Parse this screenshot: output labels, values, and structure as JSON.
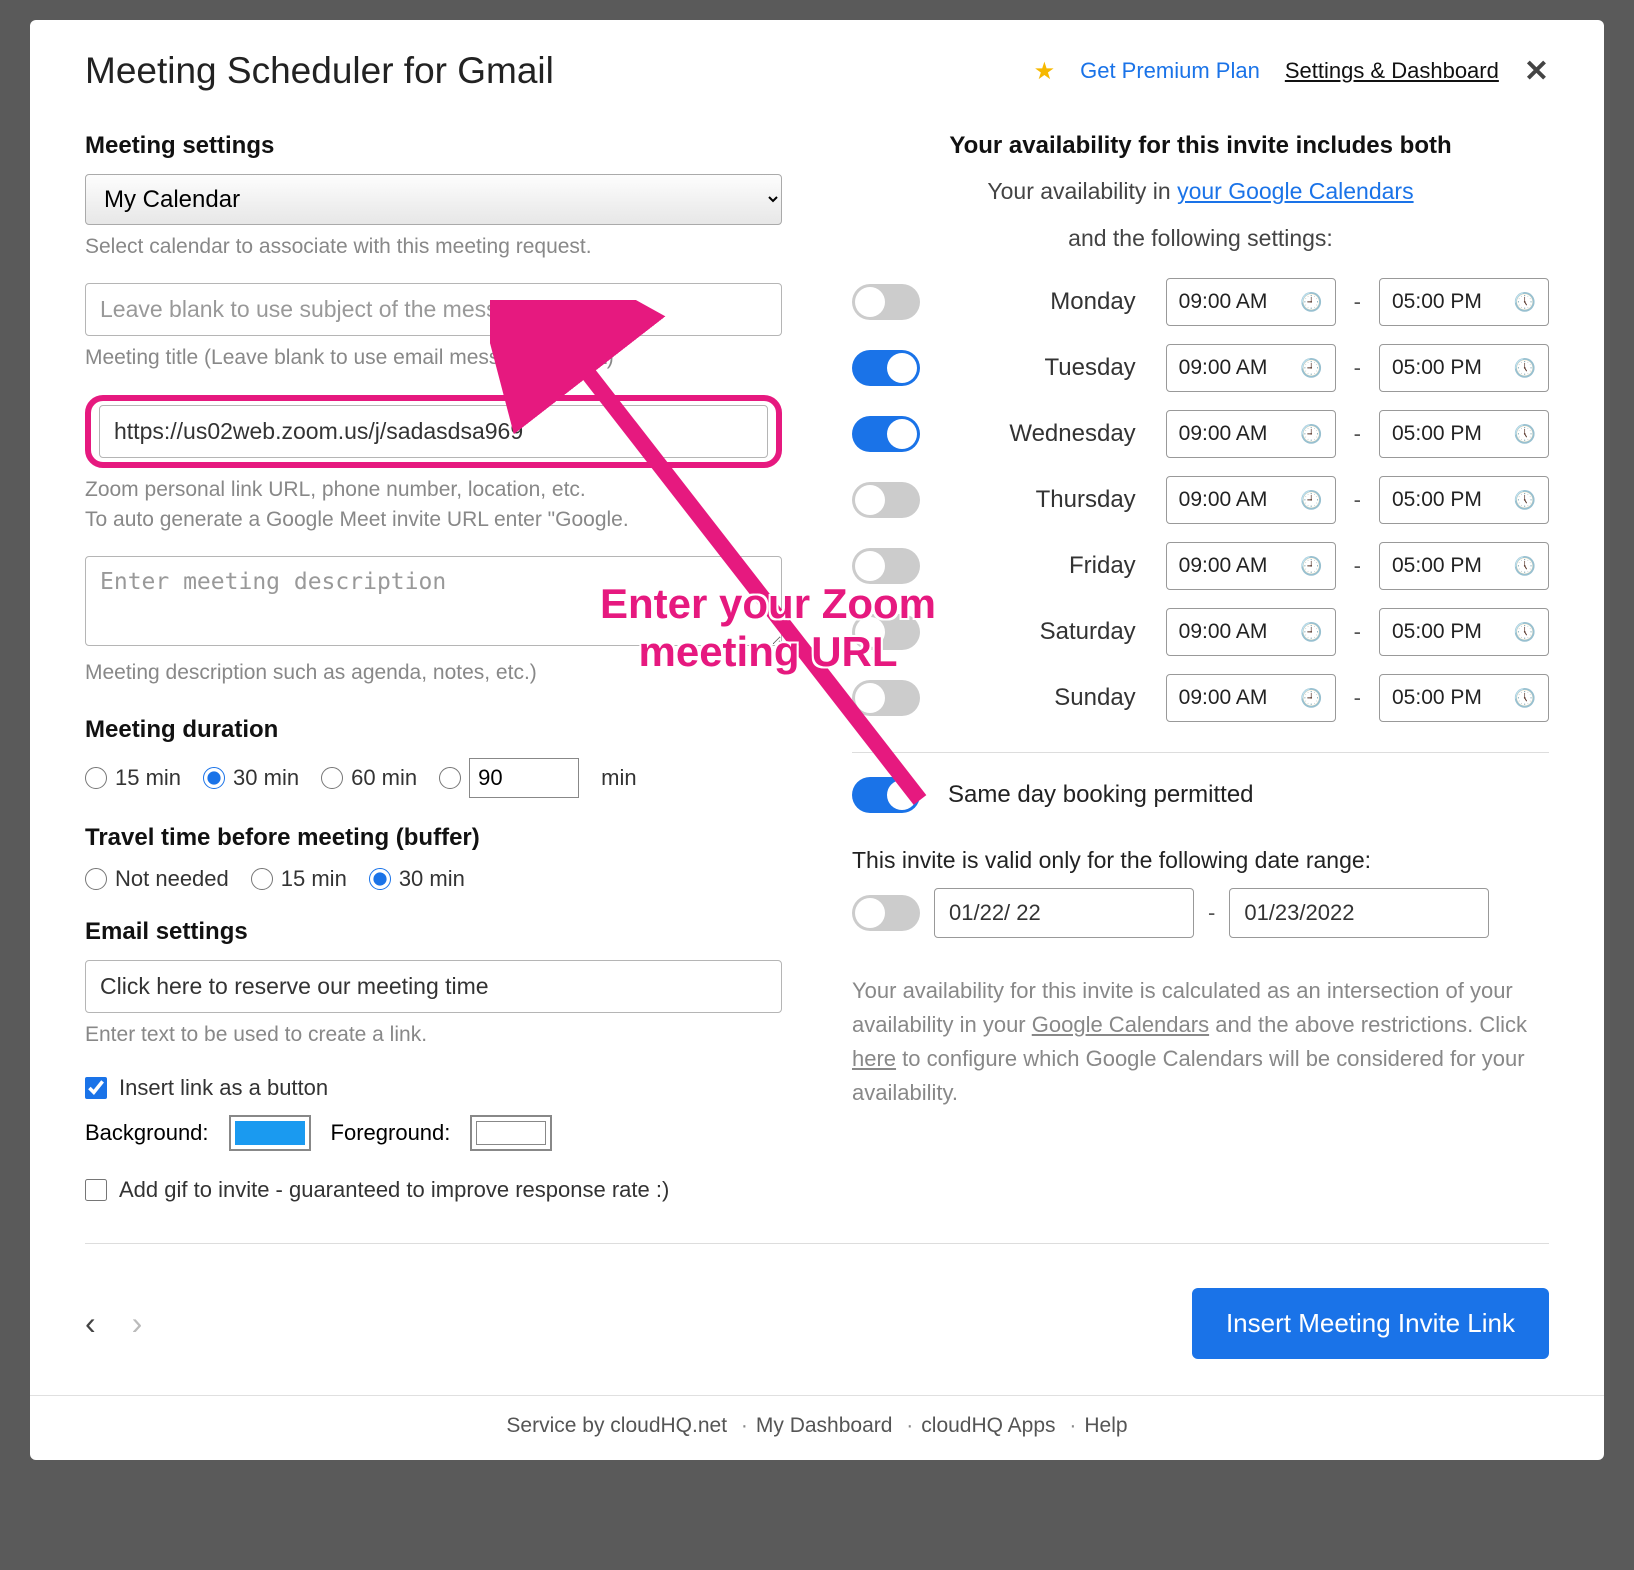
{
  "title": "Meeting Scheduler for Gmail",
  "header": {
    "premium": "Get Premium Plan",
    "settings": "Settings & Dashboard"
  },
  "left": {
    "settings_h": "Meeting settings",
    "calendar_value": "My Calendar",
    "calendar_help": "Select calendar to associate with this meeting request.",
    "title_placeholder": "Leave blank to use subject of the message",
    "title_help": "Meeting title (Leave blank to use email message subject)",
    "zoom_value": "https://us02web.zoom.us/j/sadasdsa969",
    "zoom_help1": "Zoom personal link URL, phone number, location, etc.",
    "zoom_help2": "To auto generate a Google Meet invite URL enter \"Google.",
    "desc_placeholder": "Enter meeting description",
    "desc_help": "Meeting description such as agenda, notes, etc.)",
    "duration_h": "Meeting duration",
    "dur_opts": [
      "15 min",
      "30 min",
      "60 min"
    ],
    "dur_custom": "90",
    "dur_min": "min",
    "buffer_h": "Travel time before meeting (buffer)",
    "buffer_opts": [
      "Not needed",
      "15 min",
      "30 min"
    ],
    "email_h": "Email settings",
    "email_value": "Click here to reserve our meeting time",
    "email_help": "Enter text to be used to create a link.",
    "insert_button_label": "Insert link as a button",
    "bg_label": "Background:",
    "fg_label": "Foreground:",
    "gif_label": "Add gif to invite - guaranteed to improve response rate :)"
  },
  "right": {
    "head": "Your availability for this invite includes both",
    "sub_prefix": "Your availability in ",
    "sub_link": "your Google Calendars",
    "sub_and": "and the following settings:",
    "days": [
      {
        "name": "Monday",
        "on": false,
        "start": "09:00 AM",
        "end": "05:00 PM"
      },
      {
        "name": "Tuesday",
        "on": true,
        "start": "09:00 AM",
        "end": "05:00 PM"
      },
      {
        "name": "Wednesday",
        "on": true,
        "start": "09:00 AM",
        "end": "05:00 PM"
      },
      {
        "name": "Thursday",
        "on": false,
        "start": "09:00 AM",
        "end": "05:00 PM"
      },
      {
        "name": "Friday",
        "on": false,
        "start": "09:00 AM",
        "end": "05:00 PM"
      },
      {
        "name": "Saturday",
        "on": false,
        "start": "09:00 AM",
        "end": "05:00 PM"
      },
      {
        "name": "Sunday",
        "on": false,
        "start": "09:00 AM",
        "end": "05:00 PM"
      }
    ],
    "same_day": "Same day booking permitted",
    "range_head": "This invite is valid only for the following date range:",
    "date_from": "01/22/    22",
    "date_to": "01/23/2022",
    "note_1": "Your availability for this invite is calculated as an intersection of your availability in your ",
    "note_link1": "Google Calendars",
    "note_2": " and the above restrictions. Click ",
    "note_link2": "here",
    "note_3": " to configure which Google Calendars will be considered for your availability."
  },
  "footer": {
    "insert_btn": "Insert Meeting Invite Link",
    "service_prefix": "Service by ",
    "service_name": "cloudHQ.net",
    "links": [
      "My Dashboard",
      "cloudHQ Apps",
      "Help"
    ]
  },
  "annotation": {
    "line1": "Enter your Zoom",
    "line2": "meeting URL"
  }
}
